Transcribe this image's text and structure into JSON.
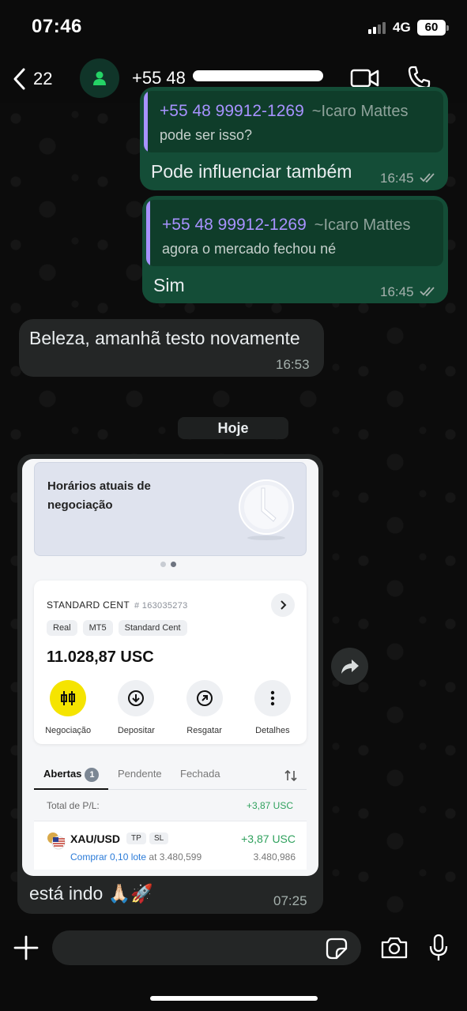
{
  "status_bar": {
    "time": "07:46",
    "network": "4G",
    "battery": "60"
  },
  "header": {
    "back_count": "22",
    "contact_name": "+55 48"
  },
  "messages": [
    {
      "quote": {
        "phone": "+55 48 99912-1269",
        "alias": "~Icaro Mattes",
        "text": "pode ser isso?"
      },
      "text": "Pode influenciar também",
      "time": "16:45"
    },
    {
      "quote": {
        "phone": "+55 48 99912-1269",
        "alias": "~Icaro Mattes",
        "text": "agora o mercado fechou né"
      },
      "text": "Sim",
      "time": "16:45"
    },
    {
      "text": "Beleza, amanhã testo novamente",
      "time": "16:53"
    }
  ],
  "date_chip": "Hoje",
  "screenshot": {
    "banner_title": "Horários atuais de negociação",
    "account": {
      "name": "STANDARD CENT",
      "number": "# 163035273",
      "tags": [
        "Real",
        "MT5",
        "Standard Cent"
      ],
      "balance": "11.028,87 USC",
      "actions": [
        {
          "label": "Negociação",
          "icon": "candlestick-icon"
        },
        {
          "label": "Depositar",
          "icon": "download-icon"
        },
        {
          "label": "Resgatar",
          "icon": "withdraw-icon"
        },
        {
          "label": "Detalhes",
          "icon": "more-icon"
        }
      ]
    },
    "tabs": {
      "open": "Abertas",
      "open_count": "1",
      "pending": "Pendente",
      "closed": "Fechada"
    },
    "pl_label": "Total de P/L:",
    "pl_value": "+3,87 USC",
    "position": {
      "symbol": "XAU/USD",
      "tp": "TP",
      "sl": "SL",
      "pl": "+3,87 USC",
      "action": "Comprar 0,10 lote",
      "at": "at 3.480,599",
      "price": "3.480,986"
    }
  },
  "image_caption": {
    "text": "está indo 🙏🏻🚀",
    "time": "07:25"
  },
  "colors": {
    "outgoing_bubble": "#144d37",
    "incoming_bubble": "#242626",
    "quote_accent": "#a792ff",
    "profit_green": "#2fa15d",
    "action_yellow": "#f5e400"
  }
}
